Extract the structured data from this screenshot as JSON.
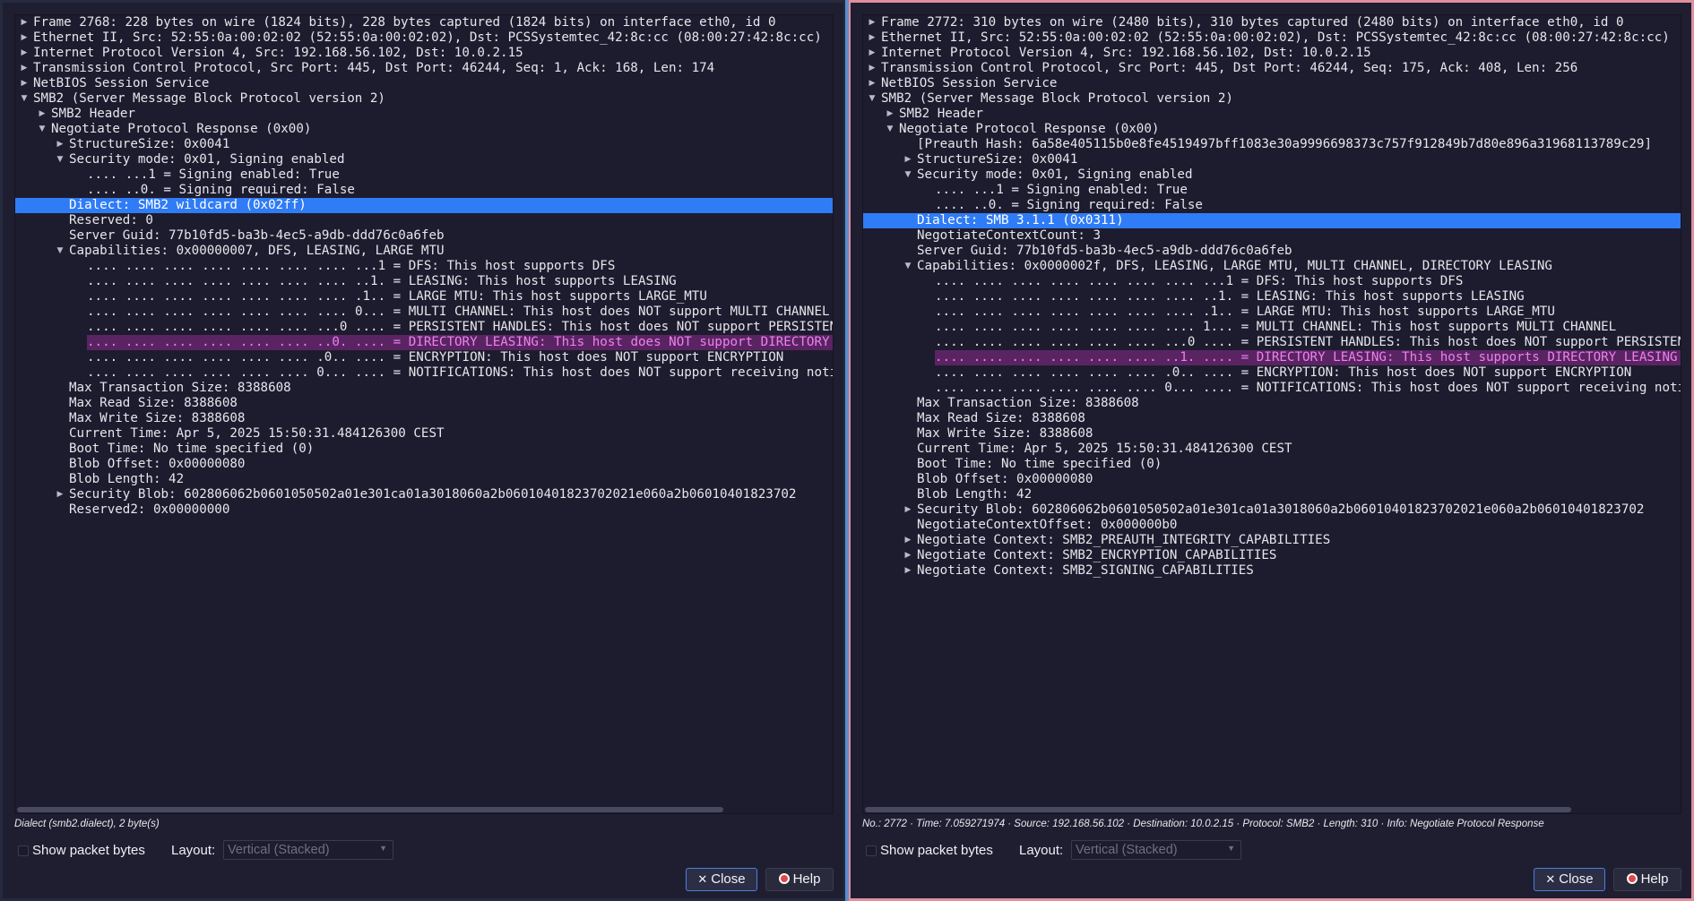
{
  "colors": {
    "selection": "#2f7cf6",
    "warning_text": "#ee80ee",
    "warning_bg": "#5a2463",
    "left_window_border": "#262a3f",
    "right_window_border": "#e08f9d"
  },
  "left": {
    "rows": [
      {
        "text": "Frame 2768: 228 bytes on wire (1824 bits), 228 bytes captured (1824 bits) on interface eth0, id 0",
        "level": 0,
        "exp": "c",
        "hl": ""
      },
      {
        "text": "Ethernet II, Src: 52:55:0a:00:02:02 (52:55:0a:00:02:02), Dst: PCSSystemtec_42:8c:cc (08:00:27:42:8c:cc)",
        "level": 0,
        "exp": "c",
        "hl": ""
      },
      {
        "text": "Internet Protocol Version 4, Src: 192.168.56.102, Dst: 10.0.2.15",
        "level": 0,
        "exp": "c",
        "hl": ""
      },
      {
        "text": "Transmission Control Protocol, Src Port: 445, Dst Port: 46244, Seq: 1, Ack: 168, Len: 174",
        "level": 0,
        "exp": "c",
        "hl": ""
      },
      {
        "text": "NetBIOS Session Service",
        "level": 0,
        "exp": "c",
        "hl": ""
      },
      {
        "text": "SMB2 (Server Message Block Protocol version 2)",
        "level": 0,
        "exp": "e",
        "hl": ""
      },
      {
        "text": "SMB2 Header",
        "level": 1,
        "exp": "c",
        "hl": ""
      },
      {
        "text": "Negotiate Protocol Response (0x00)",
        "level": 1,
        "exp": "e",
        "hl": ""
      },
      {
        "text": "StructureSize: 0x0041",
        "level": 2,
        "exp": "c",
        "hl": ""
      },
      {
        "text": "Security mode: 0x01, Signing enabled",
        "level": 2,
        "exp": "e",
        "hl": ""
      },
      {
        "text": ".... ...1 = Signing enabled: True",
        "level": 3,
        "exp": "",
        "hl": ""
      },
      {
        "text": ".... ..0. = Signing required: False",
        "level": 3,
        "exp": "",
        "hl": ""
      },
      {
        "text": "Dialect: SMB2 wildcard (0x02ff)",
        "level": 2,
        "exp": "",
        "hl": "sel"
      },
      {
        "text": "Reserved: 0",
        "level": 2,
        "exp": "",
        "hl": ""
      },
      {
        "text": "Server Guid: 77b10fd5-ba3b-4ec5-a9db-ddd76c0a6feb",
        "level": 2,
        "exp": "",
        "hl": ""
      },
      {
        "text": "Capabilities: 0x00000007, DFS, LEASING, LARGE MTU",
        "level": 2,
        "exp": "e",
        "hl": ""
      },
      {
        "text": ".... .... .... .... .... .... .... ...1 = DFS: This host supports DFS",
        "level": 3,
        "exp": "",
        "hl": ""
      },
      {
        "text": ".... .... .... .... .... .... .... ..1. = LEASING: This host supports LEASING",
        "level": 3,
        "exp": "",
        "hl": ""
      },
      {
        "text": ".... .... .... .... .... .... .... .1.. = LARGE MTU: This host supports LARGE_MTU",
        "level": 3,
        "exp": "",
        "hl": ""
      },
      {
        "text": ".... .... .... .... .... .... .... 0... = MULTI CHANNEL: This host does NOT support MULTI CHANNEL",
        "level": 3,
        "exp": "",
        "hl": ""
      },
      {
        "text": ".... .... .... .... .... .... ...0 .... = PERSISTENT HANDLES: This host does NOT support PERSISTENT HANDLES",
        "level": 3,
        "exp": "",
        "hl": ""
      },
      {
        "text": ".... .... .... .... .... .... ..0. .... = DIRECTORY LEASING: This host does NOT support DIRECTORY LEASING",
        "level": 3,
        "exp": "",
        "hl": "warn"
      },
      {
        "text": ".... .... .... .... .... .... .0.. .... = ENCRYPTION: This host does NOT support ENCRYPTION",
        "level": 3,
        "exp": "",
        "hl": ""
      },
      {
        "text": ".... .... .... .... .... .... 0... .... = NOTIFICATIONS: This host does NOT support receiving notification messages",
        "level": 3,
        "exp": "",
        "hl": ""
      },
      {
        "text": "Max Transaction Size: 8388608",
        "level": 2,
        "exp": "",
        "hl": ""
      },
      {
        "text": "Max Read Size: 8388608",
        "level": 2,
        "exp": "",
        "hl": ""
      },
      {
        "text": "Max Write Size: 8388608",
        "level": 2,
        "exp": "",
        "hl": ""
      },
      {
        "text": "Current Time: Apr  5, 2025 15:50:31.484126300 CEST",
        "level": 2,
        "exp": "",
        "hl": ""
      },
      {
        "text": "Boot Time: No time specified (0)",
        "level": 2,
        "exp": "",
        "hl": ""
      },
      {
        "text": "Blob Offset: 0x00000080",
        "level": 2,
        "exp": "",
        "hl": ""
      },
      {
        "text": "Blob Length: 42",
        "level": 2,
        "exp": "",
        "hl": ""
      },
      {
        "text": "Security Blob: 602806062b0601050502a01e301ca01a3018060a2b06010401823702021e060a2b06010401823702",
        "level": 2,
        "exp": "c",
        "hl": ""
      },
      {
        "text": "Reserved2: 0x00000000",
        "level": 2,
        "exp": "",
        "hl": ""
      }
    ],
    "status_text": "Dialect (smb2.dialect), 2 byte(s)",
    "show_bytes_label": "Show packet bytes",
    "layout_label": "Layout:",
    "layout_value": "Vertical (Stacked)",
    "close_label": "Close",
    "help_label": "Help"
  },
  "right": {
    "rows": [
      {
        "text": "Frame 2772: 310 bytes on wire (2480 bits), 310 bytes captured (2480 bits) on interface eth0, id 0",
        "level": 0,
        "exp": "c",
        "hl": ""
      },
      {
        "text": "Ethernet II, Src: 52:55:0a:00:02:02 (52:55:0a:00:02:02), Dst: PCSSystemtec_42:8c:cc (08:00:27:42:8c:cc)",
        "level": 0,
        "exp": "c",
        "hl": ""
      },
      {
        "text": "Internet Protocol Version 4, Src: 192.168.56.102, Dst: 10.0.2.15",
        "level": 0,
        "exp": "c",
        "hl": ""
      },
      {
        "text": "Transmission Control Protocol, Src Port: 445, Dst Port: 46244, Seq: 175, Ack: 408, Len: 256",
        "level": 0,
        "exp": "c",
        "hl": ""
      },
      {
        "text": "NetBIOS Session Service",
        "level": 0,
        "exp": "c",
        "hl": ""
      },
      {
        "text": "SMB2 (Server Message Block Protocol version 2)",
        "level": 0,
        "exp": "e",
        "hl": ""
      },
      {
        "text": "SMB2 Header",
        "level": 1,
        "exp": "c",
        "hl": ""
      },
      {
        "text": "Negotiate Protocol Response (0x00)",
        "level": 1,
        "exp": "e",
        "hl": ""
      },
      {
        "text": "[Preauth Hash: 6a58e405115b0e8fe4519497bff1083e30a9996698373c757f912849b7d80e896a31968113789c29]",
        "level": 2,
        "exp": "",
        "hl": ""
      },
      {
        "text": "StructureSize: 0x0041",
        "level": 2,
        "exp": "c",
        "hl": ""
      },
      {
        "text": "Security mode: 0x01, Signing enabled",
        "level": 2,
        "exp": "e",
        "hl": ""
      },
      {
        "text": ".... ...1 = Signing enabled: True",
        "level": 3,
        "exp": "",
        "hl": ""
      },
      {
        "text": ".... ..0. = Signing required: False",
        "level": 3,
        "exp": "",
        "hl": ""
      },
      {
        "text": "Dialect: SMB 3.1.1 (0x0311)",
        "level": 2,
        "exp": "",
        "hl": "sel"
      },
      {
        "text": "NegotiateContextCount: 3",
        "level": 2,
        "exp": "",
        "hl": ""
      },
      {
        "text": "Server Guid: 77b10fd5-ba3b-4ec5-a9db-ddd76c0a6feb",
        "level": 2,
        "exp": "",
        "hl": ""
      },
      {
        "text": "Capabilities: 0x0000002f, DFS, LEASING, LARGE MTU, MULTI CHANNEL, DIRECTORY LEASING",
        "level": 2,
        "exp": "e",
        "hl": ""
      },
      {
        "text": ".... .... .... .... .... .... .... ...1 = DFS: This host supports DFS",
        "level": 3,
        "exp": "",
        "hl": ""
      },
      {
        "text": ".... .... .... .... .... .... .... ..1. = LEASING: This host supports LEASING",
        "level": 3,
        "exp": "",
        "hl": ""
      },
      {
        "text": ".... .... .... .... .... .... .... .1.. = LARGE MTU: This host supports LARGE_MTU",
        "level": 3,
        "exp": "",
        "hl": ""
      },
      {
        "text": ".... .... .... .... .... .... .... 1... = MULTI CHANNEL: This host supports MULTI CHANNEL",
        "level": 3,
        "exp": "",
        "hl": ""
      },
      {
        "text": ".... .... .... .... .... .... ...0 .... = PERSISTENT HANDLES: This host does NOT support PERSISTENT HANDLES",
        "level": 3,
        "exp": "",
        "hl": ""
      },
      {
        "text": ".... .... .... .... .... .... ..1. .... = DIRECTORY LEASING: This host supports DIRECTORY LEASING",
        "level": 3,
        "exp": "",
        "hl": "warn"
      },
      {
        "text": ".... .... .... .... .... .... .0.. .... = ENCRYPTION: This host does NOT support ENCRYPTION",
        "level": 3,
        "exp": "",
        "hl": ""
      },
      {
        "text": ".... .... .... .... .... .... 0... .... = NOTIFICATIONS: This host does NOT support receiving notification messages",
        "level": 3,
        "exp": "",
        "hl": ""
      },
      {
        "text": "Max Transaction Size: 8388608",
        "level": 2,
        "exp": "",
        "hl": ""
      },
      {
        "text": "Max Read Size: 8388608",
        "level": 2,
        "exp": "",
        "hl": ""
      },
      {
        "text": "Max Write Size: 8388608",
        "level": 2,
        "exp": "",
        "hl": ""
      },
      {
        "text": "Current Time: Apr  5, 2025 15:50:31.484126300 CEST",
        "level": 2,
        "exp": "",
        "hl": ""
      },
      {
        "text": "Boot Time: No time specified (0)",
        "level": 2,
        "exp": "",
        "hl": ""
      },
      {
        "text": "Blob Offset: 0x00000080",
        "level": 2,
        "exp": "",
        "hl": ""
      },
      {
        "text": "Blob Length: 42",
        "level": 2,
        "exp": "",
        "hl": ""
      },
      {
        "text": "Security Blob: 602806062b0601050502a01e301ca01a3018060a2b06010401823702021e060a2b06010401823702",
        "level": 2,
        "exp": "c",
        "hl": ""
      },
      {
        "text": "NegotiateContextOffset: 0x000000b0",
        "level": 2,
        "exp": "",
        "hl": ""
      },
      {
        "text": "Negotiate Context: SMB2_PREAUTH_INTEGRITY_CAPABILITIES",
        "level": 2,
        "exp": "c",
        "hl": ""
      },
      {
        "text": "Negotiate Context: SMB2_ENCRYPTION_CAPABILITIES",
        "level": 2,
        "exp": "c",
        "hl": ""
      },
      {
        "text": "Negotiate Context: SMB2_SIGNING_CAPABILITIES",
        "level": 2,
        "exp": "c",
        "hl": ""
      }
    ],
    "status_text": "No.: 2772 · Time: 7.059271974 · Source: 192.168.56.102 · Destination: 10.0.2.15 · Protocol: SMB2 · Length: 310 · Info: Negotiate Protocol Response",
    "show_bytes_label": "Show packet bytes",
    "layout_label": "Layout:",
    "layout_value": "Vertical (Stacked)",
    "close_label": "Close",
    "help_label": "Help"
  }
}
